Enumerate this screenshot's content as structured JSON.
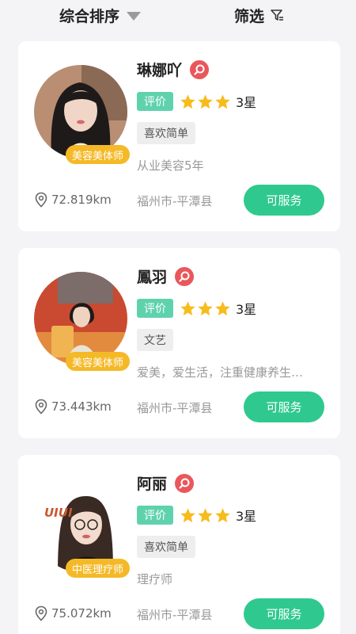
{
  "filter_bar": {
    "sort_label": "综合排序",
    "filter_label": "筛选"
  },
  "cards": [
    {
      "name": "琳娜吖",
      "role": "美容美体师",
      "rate_label": "评价",
      "stars": 3,
      "star_label": "3星",
      "tag": "喜欢简单",
      "description": "从业美容5年",
      "distance": "72.819km",
      "location": "福州市-平潭县",
      "button_label": "可服务"
    },
    {
      "name": "鳳羽",
      "role": "美容美体师",
      "rate_label": "评价",
      "stars": 3,
      "star_label": "3星",
      "tag": "文艺",
      "description": "爱美，爱生活，注重健康养生…",
      "distance": "73.443km",
      "location": "福州市-平潭县",
      "button_label": "可服务"
    },
    {
      "name": "阿丽",
      "role": "中医理疗师",
      "rate_label": "评价",
      "stars": 3,
      "star_label": "3星",
      "tag": "喜欢简单",
      "description": "理疗师",
      "distance": "75.072km",
      "location": "福州市-平潭县",
      "button_label": "可服务"
    }
  ],
  "avatar_logo_text": "UIUI",
  "colors": {
    "accent_green": "#2fc98f",
    "rate_tag_green": "#5fd2ad",
    "badge_yellow": "#f5b928",
    "star_yellow": "#f7bb1c",
    "verify_red": "#e9575c"
  }
}
